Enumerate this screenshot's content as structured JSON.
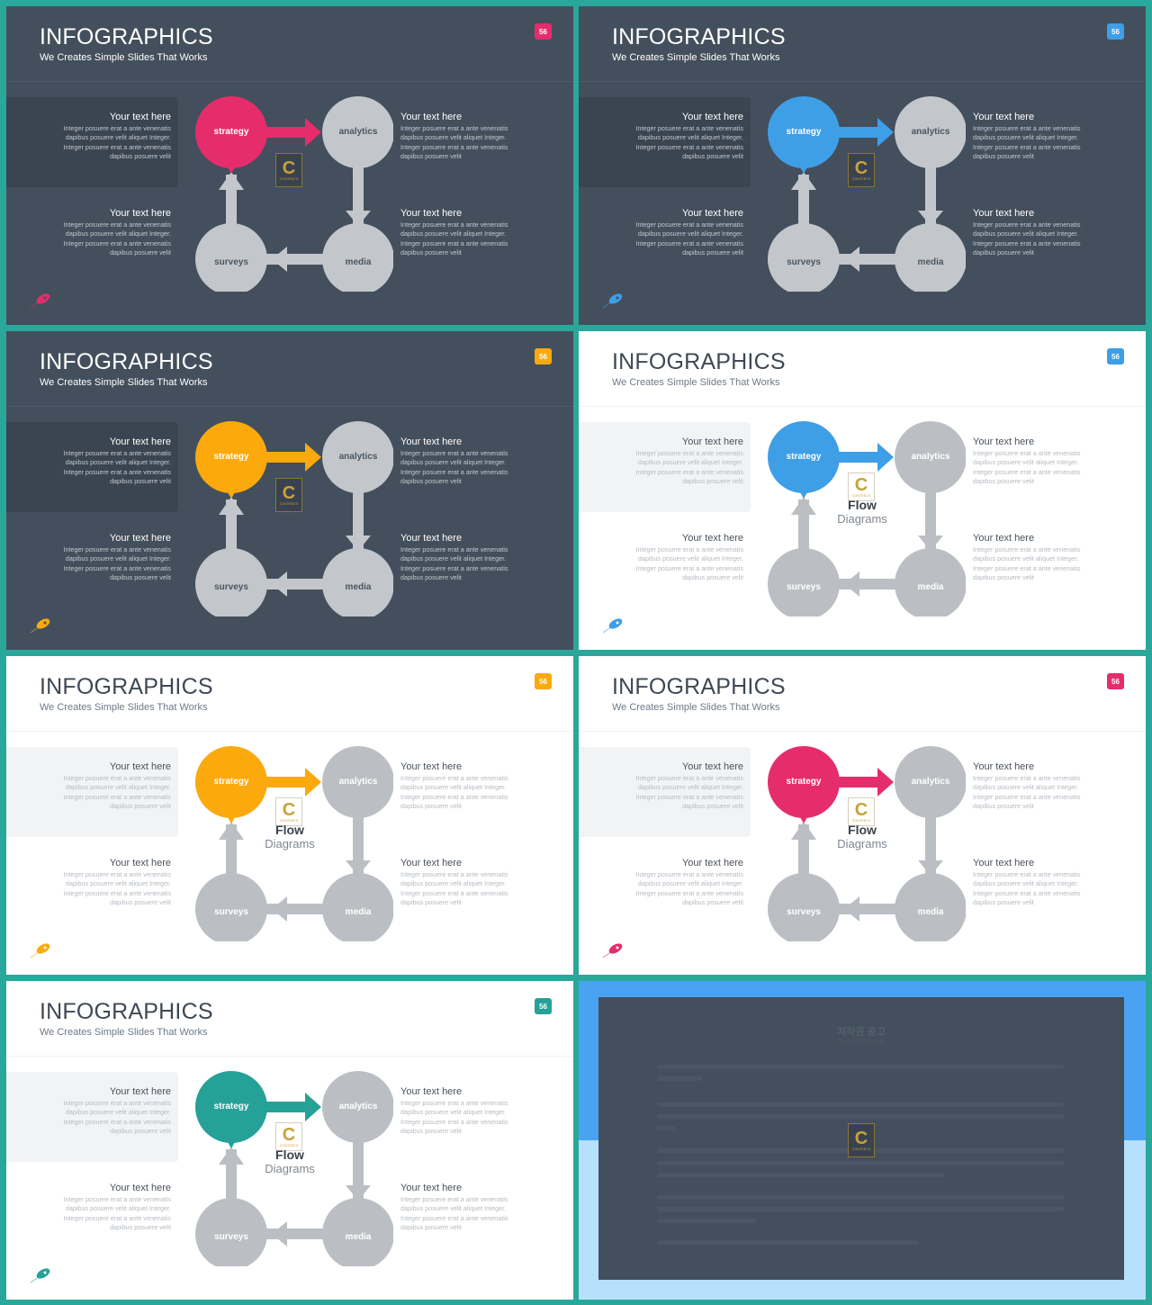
{
  "slides": [
    {
      "id": "slide-1",
      "theme": "dark",
      "accent": "#e52d6b",
      "title": "INFOGRAPHICS",
      "subtitle": "We Creates Simple Slides That Works",
      "badge": "56",
      "center_label": null
    },
    {
      "id": "slide-2",
      "theme": "dark",
      "accent": "#3e9ee6",
      "title": "INFOGRAPHICS",
      "subtitle": "We Creates Simple Slides That Works",
      "badge": "56",
      "center_label": null
    },
    {
      "id": "slide-3",
      "theme": "dark",
      "accent": "#fba90d",
      "title": "INFOGRAPHICS",
      "subtitle": "We Creates Simple Slides That Works",
      "badge": "56",
      "center_label": null
    },
    {
      "id": "slide-4",
      "theme": "light",
      "accent": "#3e9ee6",
      "title": "INFOGRAPHICS",
      "subtitle": "We Creates Simple Slides That Works",
      "badge": "56",
      "center_label": {
        "line1": "Flow",
        "line2": "Diagrams"
      }
    },
    {
      "id": "slide-5",
      "theme": "light",
      "accent": "#fba90d",
      "title": "INFOGRAPHICS",
      "subtitle": "We Creates Simple Slides That Works",
      "badge": "56",
      "center_label": {
        "line1": "Flow",
        "line2": "Diagrams"
      }
    },
    {
      "id": "slide-6",
      "theme": "light",
      "accent": "#e52d6b",
      "title": "INFOGRAPHICS",
      "subtitle": "We Creates Simple Slides That Works",
      "badge": "56",
      "center_label": {
        "line1": "Flow",
        "line2": "Diagrams"
      }
    },
    {
      "id": "slide-7",
      "theme": "light",
      "accent": "#25a197",
      "title": "INFOGRAPHICS",
      "subtitle": "We Creates Simple Slides That Works",
      "badge": "56",
      "center_label": {
        "line1": "Flow",
        "line2": "Diagrams"
      }
    }
  ],
  "diagram": {
    "nodes": [
      "strategy",
      "analytics",
      "media",
      "surveys"
    ],
    "flow": [
      "strategy",
      "analytics",
      "media",
      "surveys",
      "strategy"
    ],
    "active_node": "strategy",
    "inactive_color_dark": "#c3c7cc",
    "inactive_color_light": "#bbbfc3"
  },
  "text_blocks": [
    {
      "heading": "Your text here",
      "lines": [
        "Integer posuere erat a ante venenatis",
        "dapibus posuere velit aliquet Integer.",
        "Integer posuere erat a ante venenatis",
        "dapibus posuere velit"
      ]
    },
    {
      "heading": "Your text here",
      "lines": [
        "Integer posuere erat a ante venenatis",
        "dapibus posuere velit aliquet Integer.",
        "Integer posuere erat a ante venenatis",
        "dapibus posuere velit"
      ]
    },
    {
      "heading": "Your text here",
      "lines": [
        "Integer posuere erat a ante venenatis",
        "dapibus posuere velit aliquet Integer.",
        "Integer posuere erat a ante venenatis",
        "dapibus posuere velit"
      ]
    },
    {
      "heading": "Your text here",
      "lines": [
        "Integer posuere erat a ante venenatis",
        "dapibus posuere velit aliquet Integer.",
        "Integer posuere erat a ante venenatis",
        "dapibus posuere velit"
      ]
    }
  ],
  "logo": {
    "letter": "C",
    "text": "CONTENTS"
  },
  "icons": {
    "corner": "rocket-icon"
  },
  "copyright_slide": {
    "title": "저작권 공고",
    "subtitle": "Copyright Notice",
    "logo_letter": "C",
    "logo_text": "CONTENTS"
  },
  "colors": {
    "frame": "#2aa79b",
    "dark_bg": "#434f5c",
    "light_bg": "#ffffff"
  }
}
